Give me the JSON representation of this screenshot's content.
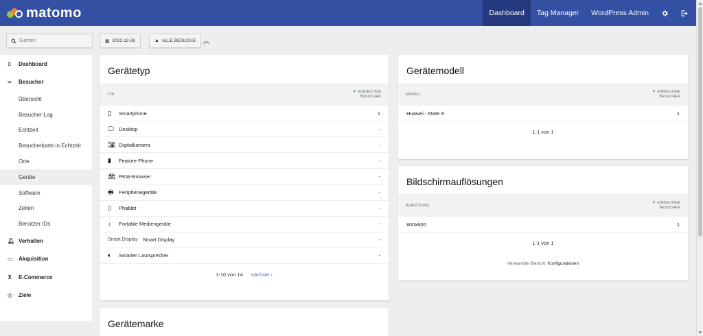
{
  "app": {
    "logo_text": "matomo",
    "nav": [
      "Dashboard",
      "Tag Manager",
      "WordPress Admin"
    ],
    "nav_icons": [
      "gear-icon",
      "logout-icon"
    ]
  },
  "controls": {
    "search_placeholder": "Suchen",
    "date": "2022-12-26",
    "segment": "ALLE BESUCHE"
  },
  "sidebar": {
    "main": [
      {
        "label": "Dashboard",
        "icon": "grid-icon"
      },
      {
        "label": "Besucher",
        "icon": "binoculars-icon"
      },
      {
        "label": "Verhalten",
        "icon": "bell-icon"
      },
      {
        "label": "Akquisition",
        "icon": "acquisition-icon"
      },
      {
        "label": "E-Commerce",
        "icon": "cart-icon"
      },
      {
        "label": "Ziele",
        "icon": "target-icon"
      }
    ],
    "sub": [
      "Übersicht",
      "Besucher-Log",
      "Echtzeit",
      "Besucherkarte in Echtzeit",
      "Orte",
      "Geräte",
      "Software",
      "Zeiten",
      "Benutzer IDs"
    ],
    "active_sub": "Geräte"
  },
  "device_type": {
    "title": "Gerätetyp",
    "col_label": "TYP",
    "col_value_1": "EINDEUTIGE",
    "col_value_2": "BESUCHER",
    "rows": [
      {
        "label": "Smartphone",
        "value": "1",
        "icon": "smartphone-icon"
      },
      {
        "label": "Desktop",
        "value": "-",
        "icon": "desktop-icon"
      },
      {
        "label": "Digitalkamera",
        "value": "-",
        "icon": "camera-icon"
      },
      {
        "label": "Feature-Phone",
        "value": "-",
        "icon": "feature-phone-icon"
      },
      {
        "label": "PKW-Browser",
        "value": "-",
        "icon": "car-icon"
      },
      {
        "label": "Peripheriegeräte",
        "value": "-",
        "icon": "printer-icon"
      },
      {
        "label": "Phablet",
        "value": "-",
        "icon": "phablet-icon"
      },
      {
        "label": "Portable Mediengeräte",
        "value": "-",
        "icon": "music-note-icon"
      },
      {
        "label": "Smart Display",
        "value": "-",
        "alt": "Smart Display"
      },
      {
        "label": "Smarter Lautsprecher",
        "value": "-",
        "icon": "speaker-icon"
      }
    ],
    "pager": "1-10 von 14",
    "next": "nächste ›"
  },
  "device_model": {
    "title": "Gerätemodell",
    "col_label": "MODELL",
    "col_value_1": "EINDEUTIGE",
    "col_value_2": "BESUCHER",
    "rows": [
      {
        "label": "Huawei - Mate 9",
        "value": "1"
      }
    ],
    "pager": "1-1 von 1"
  },
  "resolutions": {
    "title": "Bildschirmauflösungen",
    "col_label": "AUFLÖSUNG",
    "col_value_1": "EINDEUTIGE",
    "col_value_2": "BESUCHER",
    "rows": [
      {
        "label": "800x600",
        "value": "1"
      }
    ],
    "pager": "1-1 von 1",
    "related_prefix": "Verwandter Bericht:",
    "related_link": "Konfigurationen"
  },
  "device_brand": {
    "title": "Gerätemarke"
  },
  "colors": {
    "topbar": "#3450a3",
    "topbar_active": "#24397e",
    "sort_arrow": "#43a047",
    "link": "#3a6cc7"
  }
}
